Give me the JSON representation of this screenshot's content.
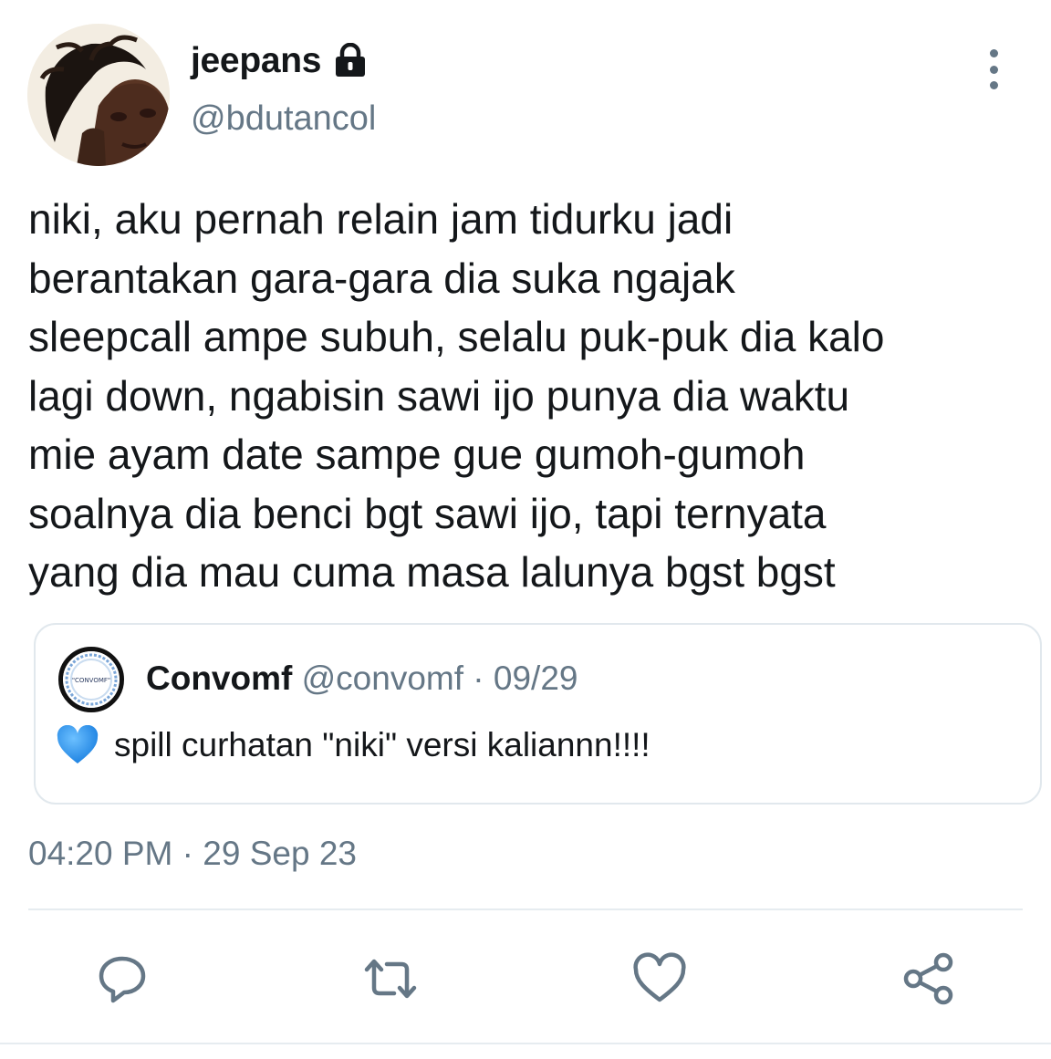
{
  "tweet": {
    "author": {
      "display_name": "jeepans",
      "handle": "@bdutancol",
      "protected_icon": "lock-icon",
      "avatar_icon": "profile-photo"
    },
    "menu_icon": "more-vertical-icon",
    "text_lines": [
      "niki, aku pernah relain jam tidurku jadi",
      "berantakan gara-gara dia suka ngajak",
      "sleepcall ampe subuh, selalu puk-puk dia kalo",
      "lagi down, ngabisin sawi ijo punya dia waktu",
      "mie ayam date sampe gue gumoh-gumoh",
      "soalnya dia benci bgt sawi ijo, tapi ternyata",
      "yang dia mau cuma masa lalunya bgst bgst"
    ],
    "quoted": {
      "display_name": "Convomf",
      "handle": "@convomf",
      "separator": "·",
      "date": "09/29",
      "avatar_text": "\"CONVOMF\"",
      "emoji_icon": "blue-heart-icon",
      "text": "spill curhatan \"niki\" versi kaliannn!!!!"
    },
    "time": "04:20 PM",
    "separator": "·",
    "date": "29 Sep 23",
    "actions": [
      "reply-icon",
      "retweet-icon",
      "like-icon",
      "share-icon"
    ],
    "colors": {
      "text": "#14171a",
      "secondary": "#657786",
      "border": "#e1e8ed",
      "heart_emoji": "#2a8ff0"
    }
  }
}
